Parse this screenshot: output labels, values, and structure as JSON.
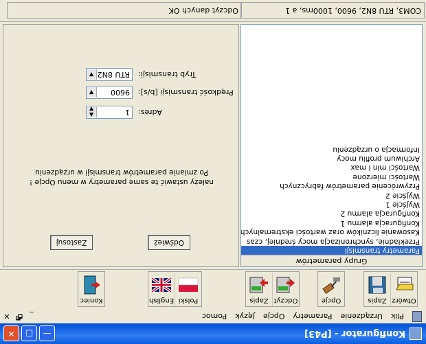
{
  "window": {
    "title": "Konfigurator - [P43]",
    "buttons": {
      "minimize": "—",
      "maximize": "□",
      "close": "✕"
    }
  },
  "menu": {
    "items": [
      "Plik",
      "Urządzenie",
      "Parametry",
      "Opcje",
      "Język",
      "Pomoc"
    ],
    "controls": [
      "_",
      "🗗",
      "✕"
    ]
  },
  "toolbar": {
    "open": "Otwórz",
    "save": "Zapis",
    "options": "Opcje",
    "read": "Odczyt",
    "write": "Zapis",
    "polish": "Polski",
    "english": "English",
    "exit": "Koniec"
  },
  "params": {
    "header": "Grupy parametrów",
    "items": [
      "Parametry transmisji",
      "Przekładnie, synchronizacja mocy średniej, czas",
      "Kasowanie liczników oraz wartości ekstremalnych",
      "Konfiguracja alarmu 1",
      "Konfiguracja alarmu 2",
      "Wyjście 1",
      "Wyjście 2",
      "Przywrócenie parametrów fabrycznych",
      "Wartości mierzone",
      "Wartości min i max",
      "Archiwum profilu mocy",
      "Informacja o urządzeniu"
    ],
    "selected_index": 0
  },
  "transmission": {
    "address_label": "Adres:",
    "address_value": "1",
    "speed_label": "Prędkość transmisji [b/s]:",
    "speed_value": "9600",
    "mode_label": "Tryb transmisji:",
    "mode_value": "RTU 8N2",
    "note_line1": "Po zmianie parametrów transmisji w urządzeniu",
    "note_line2": "należy ustawić te same parametry w menu Opcje !",
    "refresh_button": "Odśwież",
    "apply_button": "Zastosuj"
  },
  "status": {
    "connection": "COM3, RTU 8N2, 9600, 1000ms, a 1",
    "message": "Odczyt danych OK"
  }
}
